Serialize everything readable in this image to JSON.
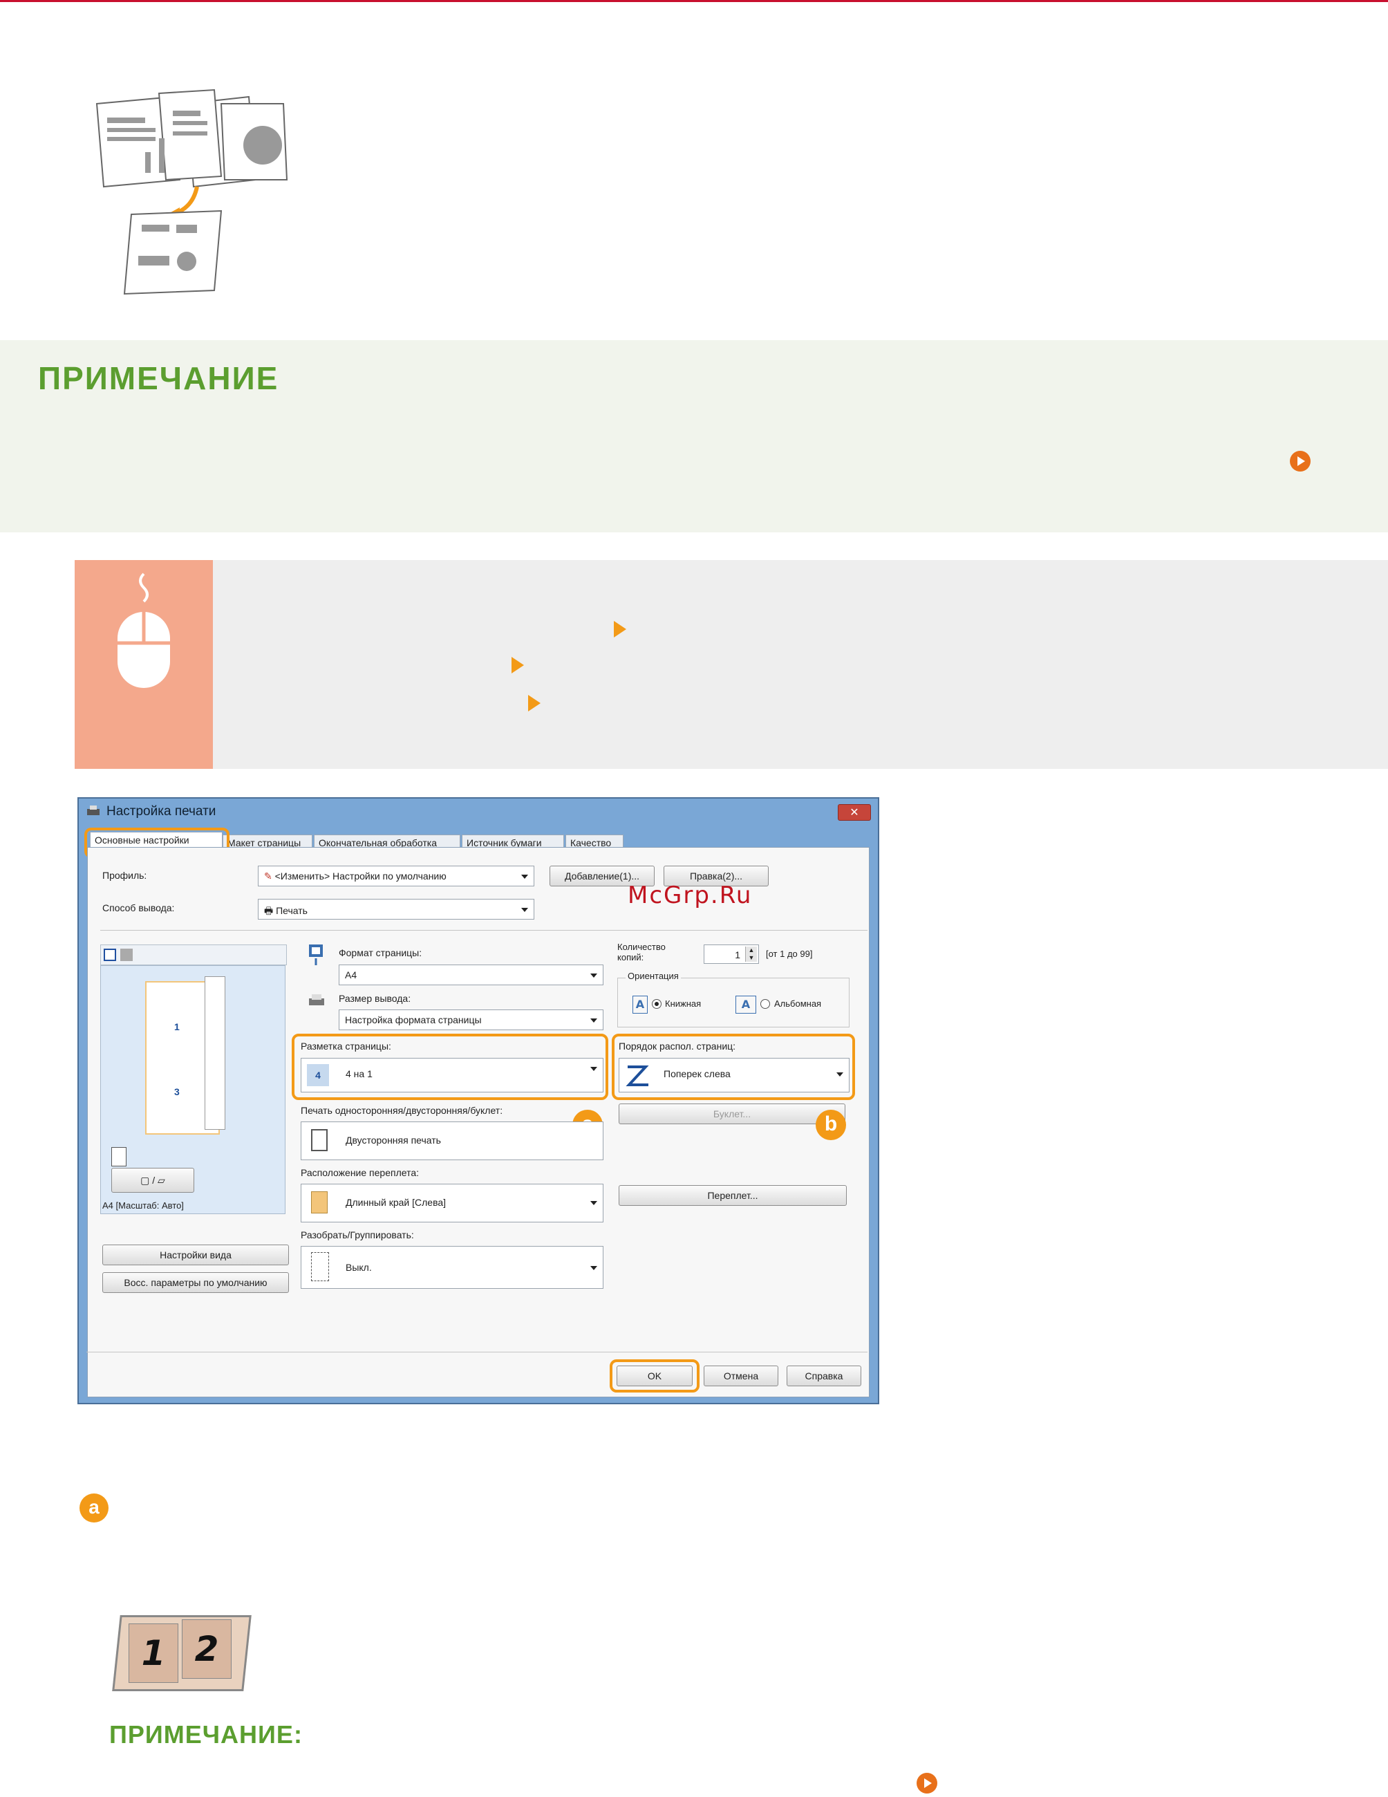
{
  "note": {
    "title": "ПРИМЕЧАНИЕ"
  },
  "dialog": {
    "title": "Настройка печати",
    "close": "✕",
    "tabs": [
      "Основные настройки",
      "Макет страницы",
      "Окончательная обработка",
      "Источник бумаги",
      "Качество"
    ],
    "profile_label": "Профиль:",
    "profile_value": "<Изменить> Настройки по умолчанию",
    "add_button": "Добавление(1)...",
    "edit_button": "Правка(2)...",
    "output_method_label": "Способ вывода:",
    "output_method_value": "Печать",
    "page_size_label": "Формат страницы:",
    "page_size_value": "A4",
    "output_size_label": "Размер вывода:",
    "output_size_value": "Настройка формата страницы",
    "copies_label": "Количество копий:",
    "copies_value": "1",
    "copies_range": "[от 1 до 99]",
    "orientation_label": "Ориентация",
    "orientation_portrait": "Книжная",
    "orientation_landscape": "Альбомная",
    "page_layout_label": "Разметка страницы:",
    "page_layout_value": "4 на 1",
    "page_layout_icon": "4",
    "page_order_label": "Порядок распол. страниц:",
    "page_order_value": "Поперек слева",
    "duplex_label": "Печать односторонняя/двусторонняя/буклет:",
    "duplex_value": "Двусторонняя печать",
    "booklet_button": "Буклет...",
    "binding_label": "Расположение переплета:",
    "binding_value": "Длинный край [Слева]",
    "binding_button": "Переплет...",
    "collate_label": "Разобрать/Группировать:",
    "collate_value": "Выкл.",
    "preview_caption": "A4 [Масштаб: Авто]",
    "preview_pages": [
      "1",
      "3"
    ],
    "view_settings_button": "Настройки вида",
    "restore_defaults_button": "Восс. параметры по умолчанию",
    "ok_button": "OK",
    "cancel_button": "Отмена",
    "help_button": "Справка",
    "badge_a": "a",
    "badge_b": "b"
  },
  "watermark": "McGrp.Ru",
  "step_badge": "a",
  "booklet_pages": [
    "1",
    "2"
  ],
  "note_sub": "ПРИМЕЧАНИЕ:",
  "colors": {
    "accent": "#f39a17",
    "note_green": "#5b9e2f",
    "link_orange": "#e8701a",
    "top_line": "#c8102e"
  }
}
